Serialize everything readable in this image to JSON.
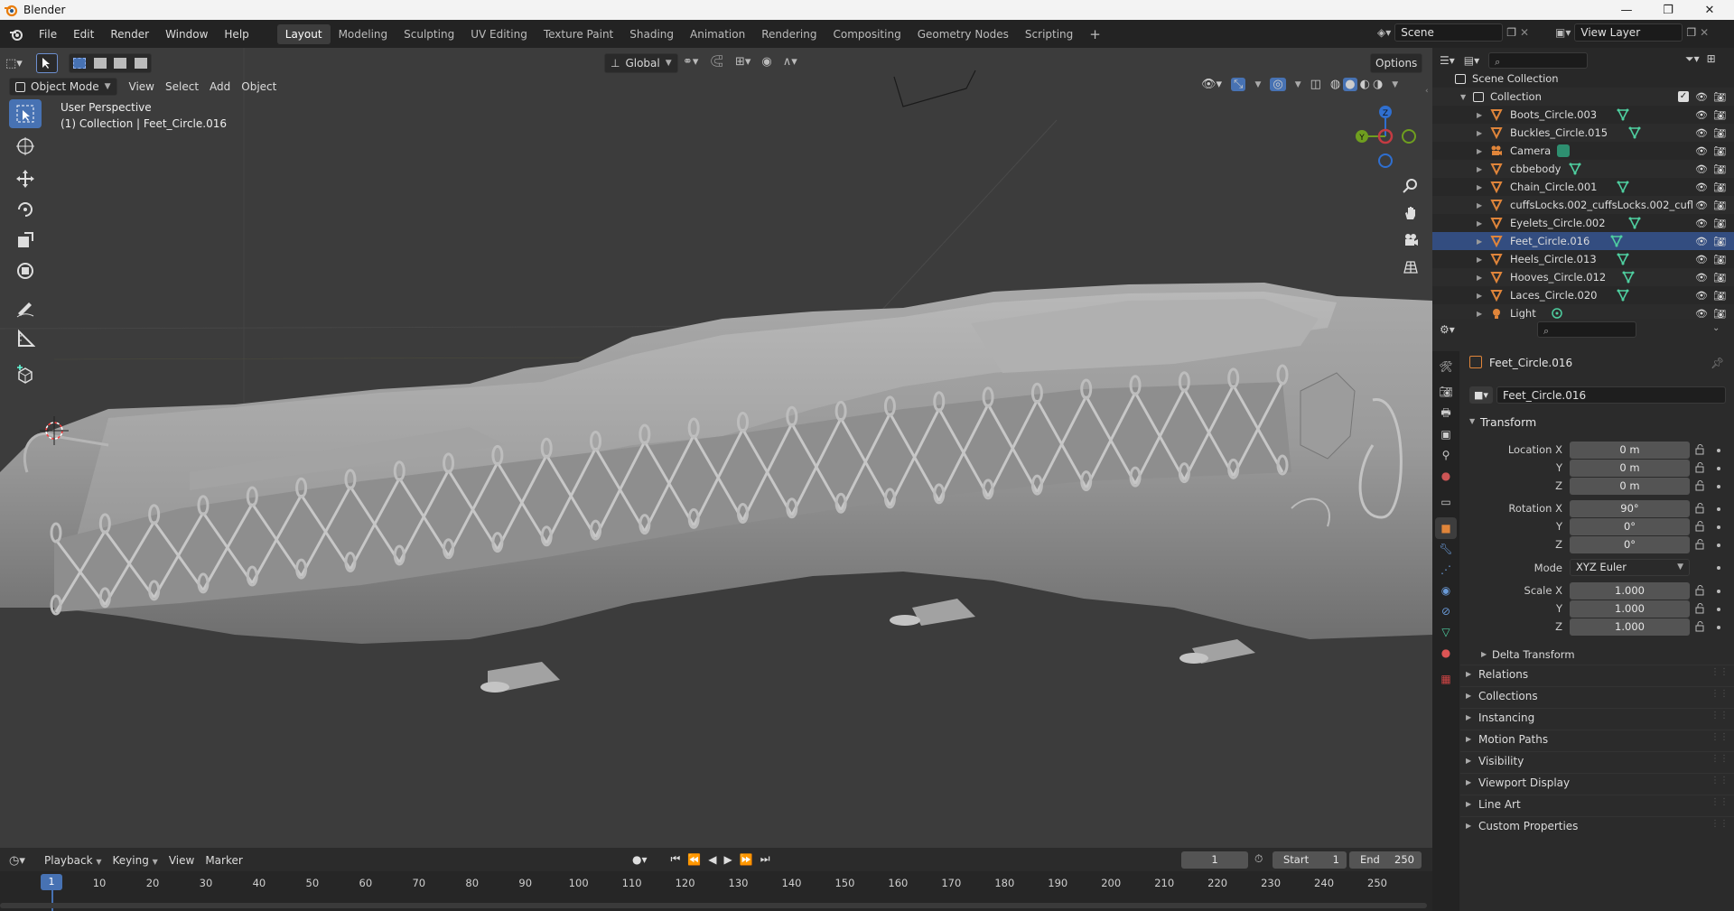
{
  "window": {
    "title": "Blender",
    "minimize": "—",
    "maximize": "❐",
    "close": "✕"
  },
  "menu": [
    "File",
    "Edit",
    "Render",
    "Window",
    "Help"
  ],
  "workspaces": {
    "tabs": [
      "Layout",
      "Modeling",
      "Sculpting",
      "UV Editing",
      "Texture Paint",
      "Shading",
      "Animation",
      "Rendering",
      "Compositing",
      "Geometry Nodes",
      "Scripting"
    ],
    "active": "Layout",
    "add": "+"
  },
  "scene": {
    "name": "Scene",
    "view_layer": "View Layer"
  },
  "viewport": {
    "mode": "Object Mode",
    "menus": [
      "View",
      "Select",
      "Add",
      "Object"
    ],
    "transform_orientation": "Global",
    "options": "Options",
    "info_line1": "User Perspective",
    "info_line2": "(1) Collection | Feet_Circle.016",
    "gizmo": {
      "x": "X",
      "y": "Y",
      "z": "Z",
      "x_color": "#c43b42",
      "y_color": "#6f9e1f",
      "z_color": "#2f6fd0"
    }
  },
  "outliner": {
    "root": "Scene Collection",
    "collection": "Collection",
    "items": [
      {
        "name": "Boots_Circle.003",
        "type": "mesh"
      },
      {
        "name": "Buckles_Circle.015",
        "type": "mesh"
      },
      {
        "name": "Camera",
        "type": "camera"
      },
      {
        "name": "cbbebody",
        "type": "mesh"
      },
      {
        "name": "Chain_Circle.001",
        "type": "mesh"
      },
      {
        "name": "cuffsLocks.002_cuffsLocks.002_cufl",
        "type": "mesh"
      },
      {
        "name": "Eyelets_Circle.002",
        "type": "mesh"
      },
      {
        "name": "Feet_Circle.016",
        "type": "mesh",
        "selected": true
      },
      {
        "name": "Heels_Circle.013",
        "type": "mesh"
      },
      {
        "name": "Hooves_Circle.012",
        "type": "mesh"
      },
      {
        "name": "Laces_Circle.020",
        "type": "mesh"
      },
      {
        "name": "Light",
        "type": "light"
      }
    ]
  },
  "properties": {
    "object_title": "Feet_Circle.016",
    "object_name": "Feet_Circle.016",
    "transform": {
      "header": "Transform",
      "location_label": "Location X",
      "location": [
        "0 m",
        "0 m",
        "0 m"
      ],
      "rotation_label": "Rotation X",
      "rotation": [
        "90°",
        "0°",
        "0°"
      ],
      "mode_label": "Mode",
      "mode": "XYZ Euler",
      "scale_label": "Scale X",
      "scale": [
        "1.000",
        "1.000",
        "1.000"
      ],
      "y": "Y",
      "z": "Z"
    },
    "delta_transform": "Delta Transform",
    "panels": [
      "Relations",
      "Collections",
      "Instancing",
      "Motion Paths",
      "Visibility",
      "Viewport Display",
      "Line Art",
      "Custom Properties"
    ]
  },
  "timeline": {
    "menus": [
      "Playback",
      "Keying",
      "View",
      "Marker"
    ],
    "current_frame": "1",
    "start_label": "Start",
    "start": "1",
    "end_label": "End",
    "end": "250",
    "ticks": [
      "10",
      "20",
      "30",
      "40",
      "50",
      "60",
      "70",
      "80",
      "90",
      "100",
      "110",
      "120",
      "130",
      "140",
      "150",
      "160",
      "170",
      "180",
      "190",
      "200",
      "210",
      "220",
      "230",
      "240",
      "250"
    ],
    "playhead": "1"
  },
  "colors": {
    "accent": "#4772b3",
    "selection": "#334d80",
    "mesh_icon": "#e0853a",
    "data_icon": "#4fcfa0"
  }
}
